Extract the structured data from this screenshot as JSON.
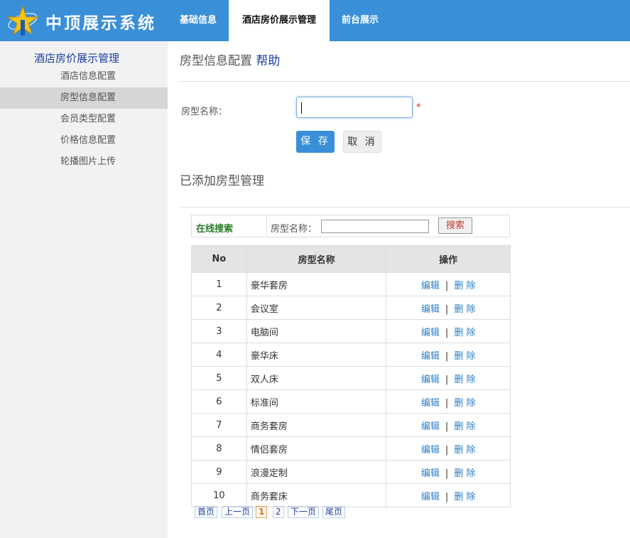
{
  "header": {
    "app_title": "中顶展示系统",
    "nav": [
      {
        "label": "基础信息"
      },
      {
        "label": "酒店房价展示管理"
      },
      {
        "label": "前台展示"
      }
    ]
  },
  "sidebar": {
    "title": "酒店房价展示管理",
    "items": [
      {
        "label": "酒店信息配置"
      },
      {
        "label": "房型信息配置"
      },
      {
        "label": "会员类型配置"
      },
      {
        "label": "价格信息配置"
      },
      {
        "label": "轮播图片上传"
      }
    ]
  },
  "form": {
    "title": "房型信息配置",
    "help": "帮助",
    "name_label": "房型名称：",
    "name_value": "",
    "required_mark": "*",
    "save_label": "保 存",
    "cancel_label": "取 消"
  },
  "list": {
    "title": "已添加房型管理",
    "search_title": "在线搜索",
    "search_label": "房型名称：",
    "search_value": "",
    "search_button": "搜索",
    "columns": [
      "No",
      "房型名称",
      "操作"
    ],
    "edit_label": "编辑",
    "separator": "|",
    "delete_label": "删 除",
    "rows": [
      {
        "no": "1",
        "name": "豪华套房"
      },
      {
        "no": "2",
        "name": "会议室"
      },
      {
        "no": "3",
        "name": "电脑间"
      },
      {
        "no": "4",
        "name": "豪华床"
      },
      {
        "no": "5",
        "name": "双人床"
      },
      {
        "no": "6",
        "name": "标准间"
      },
      {
        "no": "7",
        "name": "商务套房"
      },
      {
        "no": "8",
        "name": "情侣套房"
      },
      {
        "no": "9",
        "name": "浪漫定制"
      },
      {
        "no": "10",
        "name": "商务套床"
      }
    ]
  },
  "pager": {
    "first": "首页",
    "prev": "上一页",
    "pages": [
      "1",
      "2"
    ],
    "current": "1",
    "next": "下一页",
    "last": "尾页"
  },
  "colors": {
    "header_bg": "#3a8fd9",
    "accent": "#3a8fd9",
    "link": "#2a7fc9",
    "sidebar_bg": "#f2f2f2"
  },
  "icons": {
    "logo": "star-logo-icon"
  }
}
